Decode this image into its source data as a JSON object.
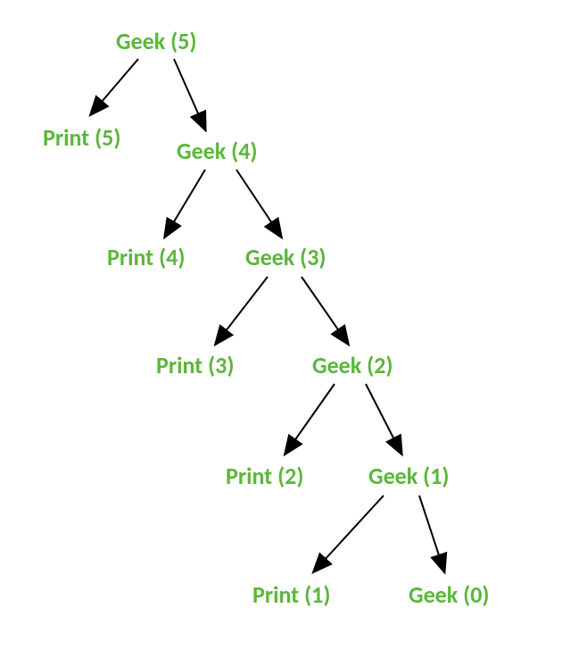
{
  "nodes": {
    "geek5": "Geek (5)",
    "print5": "Print (5)",
    "geek4": "Geek (4)",
    "print4": "Print (4)",
    "geek3": "Geek (3)",
    "print3": "Print (3)",
    "geek2": "Geek (2)",
    "print2": "Print (2)",
    "geek1": "Geek (1)",
    "print1": "Print (1)",
    "geek0": "Geek (0)"
  }
}
